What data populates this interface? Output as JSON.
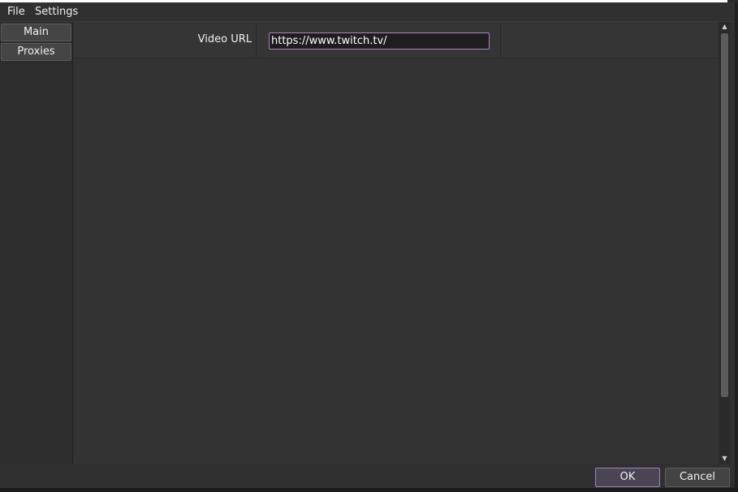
{
  "menu": {
    "file": "File",
    "settings": "Settings"
  },
  "sidebar": {
    "items": [
      {
        "label": "Main"
      },
      {
        "label": "Proxies"
      }
    ]
  },
  "form": {
    "video_url_label": "Video URL",
    "video_url_value": "https://www.twitch.tv/"
  },
  "dialog": {
    "ok_label": "OK",
    "cancel_label": "Cancel"
  },
  "icons": {
    "scroll_up": "triangle-up",
    "scroll_down": "triangle-down"
  },
  "colors": {
    "accent": "#a67fc0",
    "background": "#303030",
    "input_bg": "#1e1e1e"
  }
}
